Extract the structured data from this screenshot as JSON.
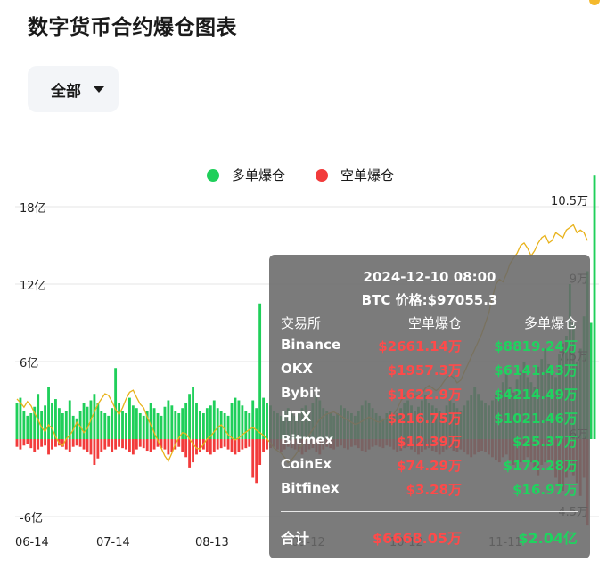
{
  "page": {
    "title": "数字货币合约爆仓图表"
  },
  "filter": {
    "selected": "全部"
  },
  "legend": [
    {
      "label": "多单爆仓",
      "color": "#1fcf5a"
    },
    {
      "label": "空单爆仓",
      "color": "#f23b3b"
    }
  ],
  "colors": {
    "long": "#1fcf5a",
    "short": "#f23b3b",
    "price": "#e8b21a",
    "grid": "#e6e6e6"
  },
  "chart_data": {
    "type": "bar",
    "left_axis": {
      "ticks": [
        "18亿",
        "12亿",
        "6亿",
        "-6亿"
      ],
      "values": [
        1800000000,
        1200000000,
        600000000,
        -600000000
      ]
    },
    "right_axis": {
      "ticks": [
        "10.5万",
        "9万",
        "7.5万",
        "6万",
        "4.5万"
      ],
      "values": [
        105000,
        90000,
        75000,
        60000,
        45000
      ]
    },
    "x_labels": [
      "06-14",
      "07-14",
      "08-13",
      "09-12",
      "10-12",
      "11-11"
    ],
    "series": [
      {
        "name": "多单爆仓",
        "type": "bar",
        "color": "#1fcf5a",
        "values": [
          0.28,
          0.32,
          0.22,
          0.18,
          0.2,
          0.25,
          0.35,
          0.22,
          0.26,
          0.4,
          0.28,
          0.31,
          0.24,
          0.2,
          0.22,
          0.3,
          0.18,
          0.16,
          0.22,
          0.28,
          0.25,
          0.3,
          0.35,
          0.28,
          0.22,
          0.2,
          0.18,
          0.24,
          0.55,
          0.28,
          0.22,
          0.2,
          0.32,
          0.26,
          0.24,
          0.2,
          0.18,
          0.22,
          0.28,
          0.24,
          0.2,
          0.18,
          0.25,
          0.3,
          0.26,
          0.22,
          0.2,
          0.24,
          0.28,
          0.35,
          0.4,
          0.28,
          0.22,
          0.2,
          0.24,
          0.26,
          0.3,
          0.24,
          0.22,
          0.2,
          0.18,
          0.28,
          0.32,
          0.3,
          0.26,
          0.22,
          0.2,
          0.3,
          0.24,
          1.05,
          0.32,
          0.28,
          0.26,
          0.22,
          0.2,
          0.18,
          0.22,
          0.24,
          0.2,
          0.18,
          0.22,
          0.24,
          0.26,
          0.2,
          0.28,
          0.35,
          0.3,
          0.24,
          0.22,
          0.2,
          0.18,
          0.2,
          0.26,
          0.24,
          0.22,
          0.2,
          0.18,
          0.22,
          0.26,
          0.3,
          0.28,
          0.24,
          0.2,
          0.18,
          0.16,
          0.2,
          0.22,
          0.18,
          0.2,
          0.24,
          0.28,
          0.3,
          0.26,
          0.22,
          0.25,
          0.3,
          0.34,
          0.28,
          0.26,
          0.24,
          0.22,
          0.2,
          0.26,
          0.3,
          0.28,
          0.24,
          0.22,
          0.26,
          0.3,
          0.34,
          0.4,
          0.35,
          0.3,
          0.28,
          0.26,
          0.3,
          0.34,
          0.38,
          0.44,
          0.5,
          0.4,
          0.36,
          0.46,
          0.52,
          0.6,
          0.48,
          0.44,
          0.4,
          0.56,
          0.62,
          0.7,
          0.58,
          0.52,
          0.48,
          0.66,
          0.74,
          0.8,
          1.2,
          0.9,
          0.6,
          0.7,
          0.95,
          1.3,
          0.9,
          2.04
        ]
      },
      {
        "name": "空单爆仓",
        "type": "bar",
        "color": "#f23b3b",
        "values": [
          0.06,
          0.08,
          0.05,
          0.04,
          0.07,
          0.1,
          0.08,
          0.06,
          0.05,
          0.12,
          0.08,
          0.06,
          0.05,
          0.06,
          0.08,
          0.1,
          0.06,
          0.05,
          0.06,
          0.08,
          0.1,
          0.12,
          0.2,
          0.15,
          0.1,
          0.08,
          0.06,
          0.1,
          0.08,
          0.06,
          0.07,
          0.08,
          0.1,
          0.12,
          0.08,
          0.06,
          0.07,
          0.09,
          0.1,
          0.08,
          0.06,
          0.07,
          0.08,
          0.12,
          0.1,
          0.08,
          0.06,
          0.1,
          0.14,
          0.22,
          0.18,
          0.12,
          0.1,
          0.08,
          0.1,
          0.12,
          0.1,
          0.08,
          0.07,
          0.06,
          0.08,
          0.1,
          0.12,
          0.1,
          0.08,
          0.07,
          0.06,
          0.3,
          0.34,
          0.2,
          0.1,
          0.08,
          0.07,
          0.06,
          0.08,
          0.1,
          0.08,
          0.06,
          0.07,
          0.08,
          0.1,
          0.12,
          0.1,
          0.08,
          0.07,
          0.1,
          0.12,
          0.08,
          0.06,
          0.07,
          0.08,
          0.06,
          0.05,
          0.07,
          0.08,
          0.06,
          0.05,
          0.07,
          0.09,
          0.1,
          0.08,
          0.06,
          0.05,
          0.06,
          0.07,
          0.05,
          0.06,
          0.08,
          0.1,
          0.09,
          0.07,
          0.06,
          0.08,
          0.1,
          0.12,
          0.1,
          0.08,
          0.07,
          0.09,
          0.1,
          0.12,
          0.1,
          0.08,
          0.07,
          0.09,
          0.1,
          0.08,
          0.1,
          0.12,
          0.14,
          0.12,
          0.1,
          0.09,
          0.1,
          0.12,
          0.14,
          0.16,
          0.18,
          0.14,
          0.12,
          0.16,
          0.2,
          0.24,
          0.18,
          0.16,
          0.14,
          0.18,
          0.22,
          0.28,
          0.2,
          0.18,
          0.16,
          0.22,
          0.3,
          0.36,
          0.4,
          0.3,
          0.24,
          0.28,
          0.34,
          0.44,
          0.3,
          0.67
        ]
      },
      {
        "name": "BTC 价格",
        "type": "line",
        "color": "#e8b21a",
        "values": [
          66500,
          65800,
          64900,
          66000,
          65200,
          63800,
          62500,
          61000,
          60200,
          61500,
          60800,
          59200,
          58000,
          57500,
          58800,
          59500,
          60500,
          62000,
          61200,
          60000,
          60800,
          62500,
          64000,
          65500,
          66500,
          67500,
          67200,
          66000,
          64500,
          63500,
          64800,
          66500,
          67800,
          68200,
          66800,
          65500,
          64800,
          63000,
          61500,
          60000,
          58500,
          57000,
          55500,
          54500,
          56000,
          57800,
          59000,
          60000,
          59800,
          58800,
          57800,
          57000,
          56800,
          57800,
          58800,
          59300,
          60200,
          61000,
          61500,
          60600,
          59600,
          59000,
          58600,
          59000,
          59600,
          60100,
          60600,
          61000,
          60500,
          60000,
          59500,
          58800,
          58000,
          57000,
          56500,
          56000,
          55200,
          54200,
          54800,
          55600,
          56600,
          57600,
          58600,
          59600,
          60600,
          61600,
          62600,
          63200,
          63600,
          63800,
          64000,
          63600,
          63200,
          62800,
          62400,
          62000,
          61600,
          61800,
          62200,
          62600,
          63000,
          62600,
          62200,
          62000,
          62400,
          62800,
          63200,
          63600,
          64600,
          66100,
          67100,
          67600,
          67300,
          66900,
          67300,
          67600,
          68600,
          69100,
          68600,
          68100,
          68600,
          69600,
          70600,
          71100,
          70600,
          69600,
          70100,
          71600,
          73100,
          74600,
          76100,
          77600,
          79100,
          81100,
          83100,
          86100,
          88600,
          89600,
          89100,
          90600,
          92600,
          93600,
          94600,
          96100,
          96600,
          95600,
          94100,
          95100,
          96600,
          97600,
          98100,
          96600,
          97100,
          98600,
          98100,
          97600,
          99100,
          99600,
          100100,
          98600,
          99100,
          98600,
          97055
        ]
      }
    ],
    "tooltip": {
      "date": "2024-12-10 08:00",
      "price": "BTC 价格:$97055.3",
      "headers": [
        "交易所",
        "空单爆仓",
        "多单爆仓"
      ],
      "rows": [
        {
          "exchange": "Binance",
          "short": "$2661.14万",
          "long": "$8819.24万"
        },
        {
          "exchange": "OKX",
          "short": "$1957.3万",
          "long": "$6141.43万"
        },
        {
          "exchange": "Bybit",
          "short": "$1622.9万",
          "long": "$4214.49万"
        },
        {
          "exchange": "HTX",
          "short": "$216.75万",
          "long": "$1021.46万"
        },
        {
          "exchange": "Bitmex",
          "short": "$12.39万",
          "long": "$25.37万"
        },
        {
          "exchange": "CoinEx",
          "short": "$74.29万",
          "long": "$172.28万"
        },
        {
          "exchange": "Bitfinex",
          "short": "$3.28万",
          "long": "$16.97万"
        }
      ],
      "total": {
        "label": "合计",
        "short": "$6668.05万",
        "long": "$2.04亿"
      }
    }
  }
}
